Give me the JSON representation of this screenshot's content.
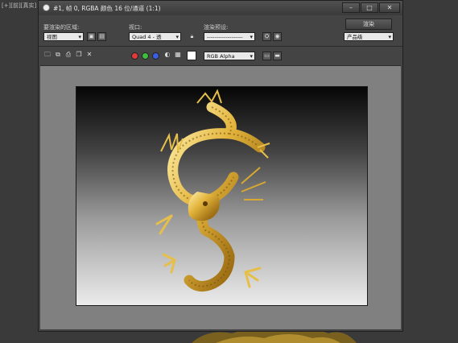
{
  "background": {
    "viewport_label": "[+][前][真实]"
  },
  "window": {
    "title": "#1, 帧 0, RGBA 颜色 16 位/通道 (1:1)",
    "min_symbol": "–",
    "max_symbol": "□",
    "close_symbol": "✕"
  },
  "toolbar": {
    "area_label": "要渲染的区域:",
    "area_value": "视图",
    "viewport_label": "视口:",
    "viewport_value": "Quad 4 - 透",
    "preset_label": "渲染预设:",
    "preset_value": "-------------------",
    "render_button": "渲染",
    "product_value": "产品级",
    "channel_value": "RGB Alpha"
  },
  "colors": {
    "red": "#e23a3a",
    "green": "#3fbf3f",
    "blue": "#3b5fe0",
    "alpha": "#ffffff"
  }
}
